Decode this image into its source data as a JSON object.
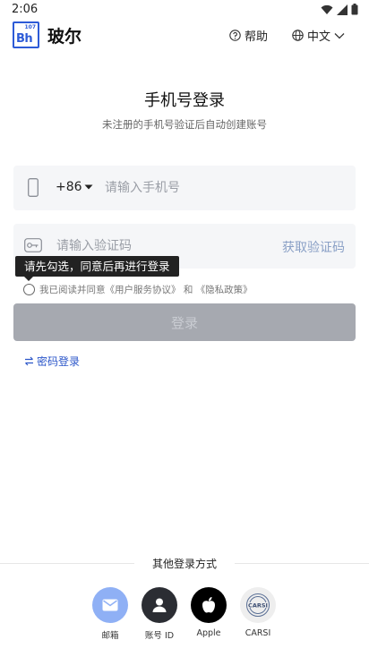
{
  "status": {
    "time": "2:06"
  },
  "header": {
    "logo_superscript": "107",
    "logo_text": "Bh",
    "brand": "玻尔",
    "help": "帮助",
    "language": "中文"
  },
  "login": {
    "title": "手机号登录",
    "subtitle": "未注册的手机号验证后自动创建账号",
    "country_code": "+86",
    "phone_placeholder": "请输入手机号",
    "code_placeholder": "请输入验证码",
    "get_code": "获取验证码",
    "tooltip": "请先勾选，同意后再进行登录",
    "agree_prefix": "我已阅读并同意",
    "agree_terms": "《用户服务协议》",
    "agree_and": "和",
    "agree_privacy": "《隐私政策》",
    "login_button": "登录",
    "password_login": "密码登录"
  },
  "other_login": {
    "title": "其他登录方式",
    "methods": [
      {
        "label": "邮箱",
        "icon": "mail-icon",
        "color": "#8fb0f5"
      },
      {
        "label": "账号 ID",
        "icon": "user-icon",
        "color": "#2b2d33"
      },
      {
        "label": "Apple",
        "icon": "apple-icon",
        "color": "#000000"
      },
      {
        "label": "CARSI",
        "icon": "carsi-icon",
        "color": "#eeeeee",
        "badge": "CARSI"
      }
    ]
  },
  "colors": {
    "accent": "#2b56c9",
    "button_disabled": "#a6a9b0",
    "field_bg": "#f5f6f8"
  }
}
